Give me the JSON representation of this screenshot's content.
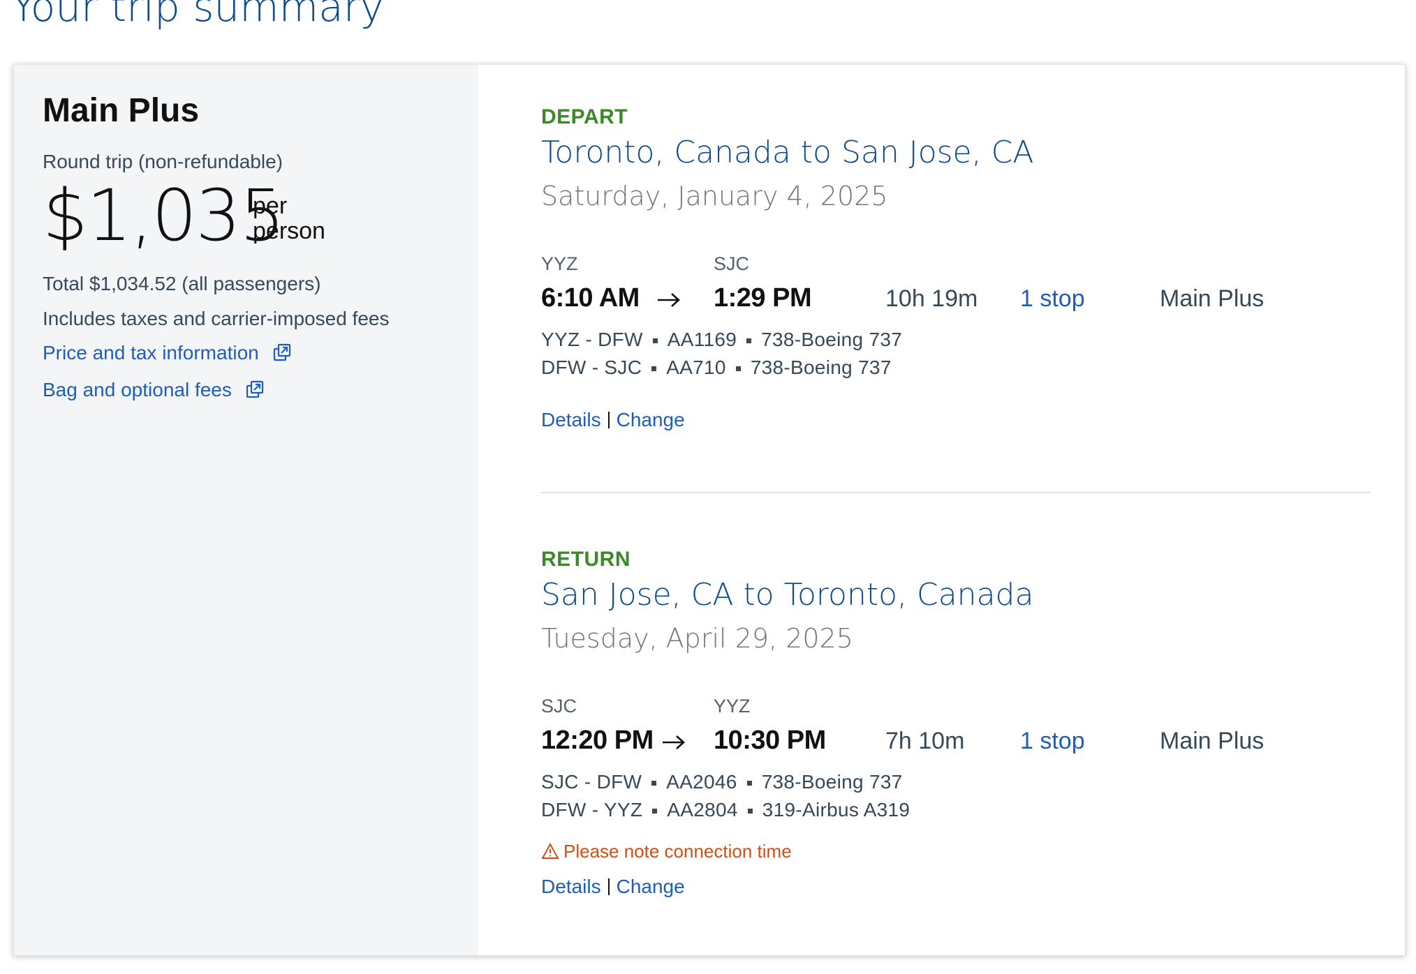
{
  "page": {
    "title": "Your trip summary"
  },
  "price_panel": {
    "fare_name": "Main Plus",
    "trip_type": "Round trip (non-refundable)",
    "price": "$1,035",
    "per_person": "per person",
    "total": "Total $1,034.52 (all passengers)",
    "includes": "Includes taxes and carrier-imposed fees",
    "price_tax_link": "Price and tax information",
    "bag_fees_link": "Bag and optional fees",
    "link_icon": "external-link-icon"
  },
  "slices": [
    {
      "direction": "DEPART",
      "route": "Toronto, Canada to San Jose, CA",
      "date": "Saturday, January 4, 2025",
      "origin_code": "YYZ",
      "destination_code": "SJC",
      "depart_time": "6:10 AM",
      "arrive_time": "1:29 PM",
      "duration": "10h 19m",
      "stops": "1 stop",
      "cabin": "Main Plus",
      "segments": [
        {
          "route": "YYZ - DFW",
          "flight": "AA1169",
          "aircraft": "738-Boeing 737"
        },
        {
          "route": "DFW - SJC",
          "flight": "AA710",
          "aircraft": "738-Boeing 737"
        }
      ],
      "warning": "",
      "details_label": "Details",
      "change_label": "Change"
    },
    {
      "direction": "RETURN",
      "route": "San Jose, CA to Toronto, Canada",
      "date": "Tuesday, April 29, 2025",
      "origin_code": "SJC",
      "destination_code": "YYZ",
      "depart_time": "12:20 PM",
      "arrive_time": "10:30 PM",
      "duration": "7h 10m",
      "stops": "1 stop",
      "cabin": "Main Plus",
      "segments": [
        {
          "route": "SJC - DFW",
          "flight": "AA2046",
          "aircraft": "738-Boeing 737"
        },
        {
          "route": "DFW - YYZ",
          "flight": "AA2804",
          "aircraft": "319-Airbus A319"
        }
      ],
      "warning": "Please note connection time",
      "details_label": "Details",
      "change_label": "Change"
    }
  ],
  "colors": {
    "title_blue": "#0b4a8c",
    "link_blue": "#1f5dbd",
    "direction_green": "#3a8a26",
    "warning_orange": "#d14e15",
    "panel_gray": "#f4f5f7"
  }
}
